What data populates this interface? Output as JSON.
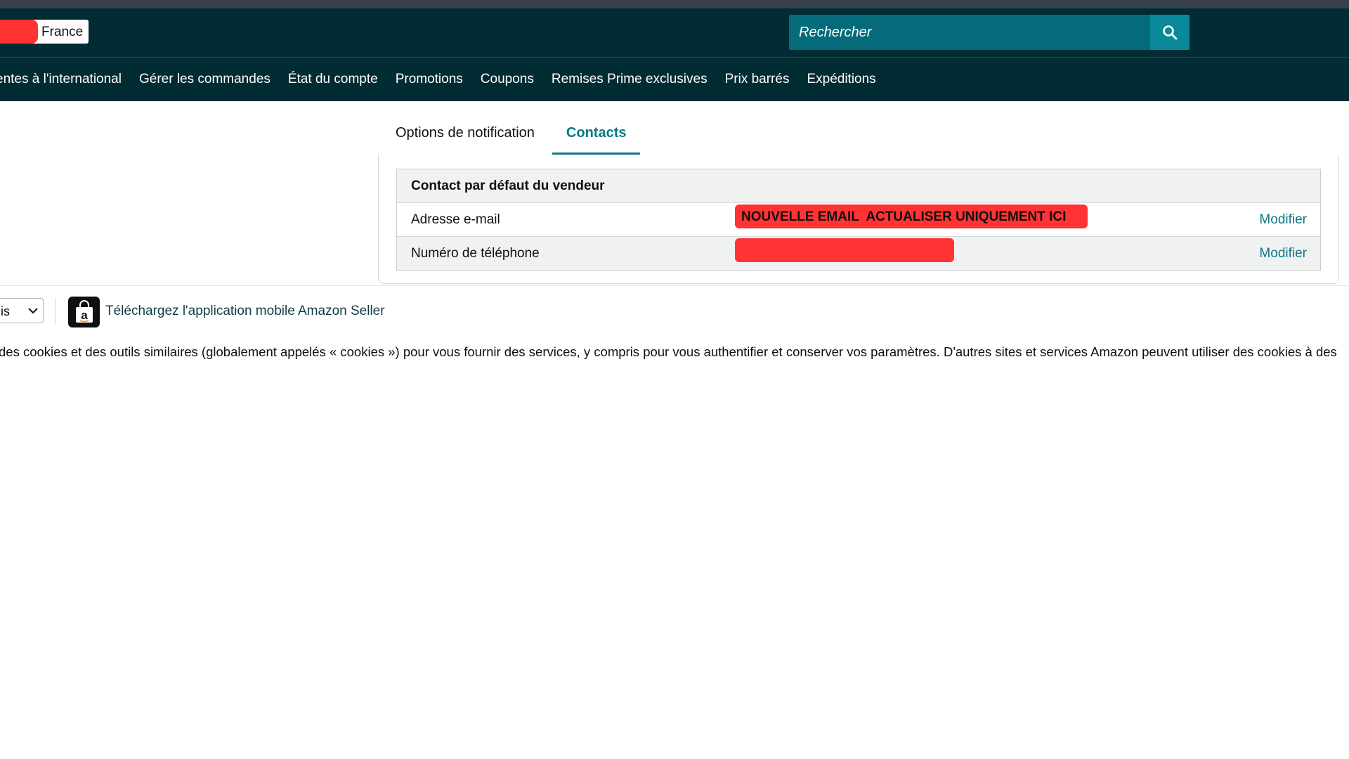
{
  "header": {
    "marketplace_label": "France",
    "search_placeholder": "Rechercher"
  },
  "nav": {
    "items": [
      "entes à l'international",
      "Gérer les commandes",
      "État du compte",
      "Promotions",
      "Coupons",
      "Remises Prime exclusives",
      "Prix barrés",
      "Expéditions"
    ]
  },
  "tabs": [
    {
      "label": "Options de notification",
      "active": false
    },
    {
      "label": "Contacts",
      "active": true
    }
  ],
  "contacts": {
    "heading": "Contact par défaut du vendeur",
    "rows": [
      {
        "label": "Adresse e-mail",
        "value_overlay": "NOUVELLE EMAIL  ACTUALISER UNIQUEMENT ICI",
        "action": "Modifier"
      },
      {
        "label": "Numéro de téléphone",
        "value_overlay": "",
        "action": "Modifier"
      }
    ]
  },
  "footer": {
    "language_value": "is",
    "app_link": "Téléchargez l'application mobile Amazon Seller",
    "cookie_text": "des cookies et des outils similaires (globalement appelés « cookies ») pour vous fournir des services, y compris pour vous authentifier et conserver vos paramètres. D'autres sites et services Amazon peuvent utiliser des cookies à des"
  },
  "colors": {
    "header_bg": "#012c33",
    "accent": "#0b7886",
    "redaction": "#ff3333"
  }
}
